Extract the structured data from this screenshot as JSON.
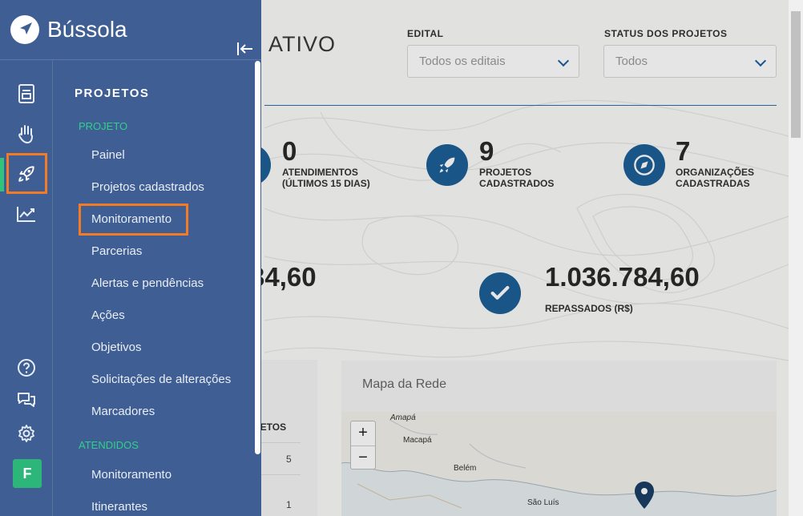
{
  "app": {
    "brand": "Bússola"
  },
  "dashboard": {
    "title_fragment": "ATIVO",
    "filters": [
      {
        "label": "EDITAL",
        "value": "Todos os editais"
      },
      {
        "label": "STATUS DOS PROJETOS",
        "value": "Todos"
      }
    ],
    "stats": [
      {
        "value": "0",
        "label": "ATENDIMENTOS (ÚLTIMOS 15 DIAS)",
        "icon": "partial-icon"
      },
      {
        "value": "9",
        "label": "PROJETOS CADASTRADOS",
        "icon": "rocket-icon"
      },
      {
        "value": "7",
        "label": "ORGANIZAÇÕES CADASTRADAS",
        "icon": "compass-icon"
      }
    ],
    "amount_left": "34,60",
    "amount_right": {
      "value": "1.036.784,60",
      "label": "REPASSADOS (R$)",
      "icon": "check-icon"
    },
    "table": {
      "header": "JETOS",
      "rows": [
        "5",
        "1"
      ]
    },
    "map": {
      "title": "Mapa da Rede",
      "zoom_in": "+",
      "zoom_out": "−",
      "cities": [
        "Amapá",
        "Macapá",
        "Belém",
        "São Luís"
      ]
    }
  },
  "sidebar": {
    "rail": [
      {
        "name": "document-icon"
      },
      {
        "name": "hand-icon"
      },
      {
        "name": "rocket-icon",
        "active": true
      },
      {
        "name": "chart-icon"
      },
      {
        "name": "help-icon"
      },
      {
        "name": "chat-icon"
      },
      {
        "name": "gear-icon"
      }
    ],
    "avatar": "F",
    "menu": {
      "heading": "PROJETOS",
      "groups": [
        {
          "label": "PROJETO",
          "items": [
            "Painel",
            "Projetos cadastrados",
            "Monitoramento",
            "Parcerias",
            "Alertas e pendências",
            "Ações",
            "Objetivos",
            "Solicitações de alterações",
            "Marcadores"
          ]
        },
        {
          "label": "ATENDIDOS",
          "items": [
            "Monitoramento",
            "Itinerantes"
          ]
        }
      ]
    }
  },
  "colors": {
    "sidebar_bg": "#3f5e94",
    "accent_green": "#2fd189",
    "highlight_orange": "#f47a26",
    "stat_blue": "#1d5f98"
  }
}
